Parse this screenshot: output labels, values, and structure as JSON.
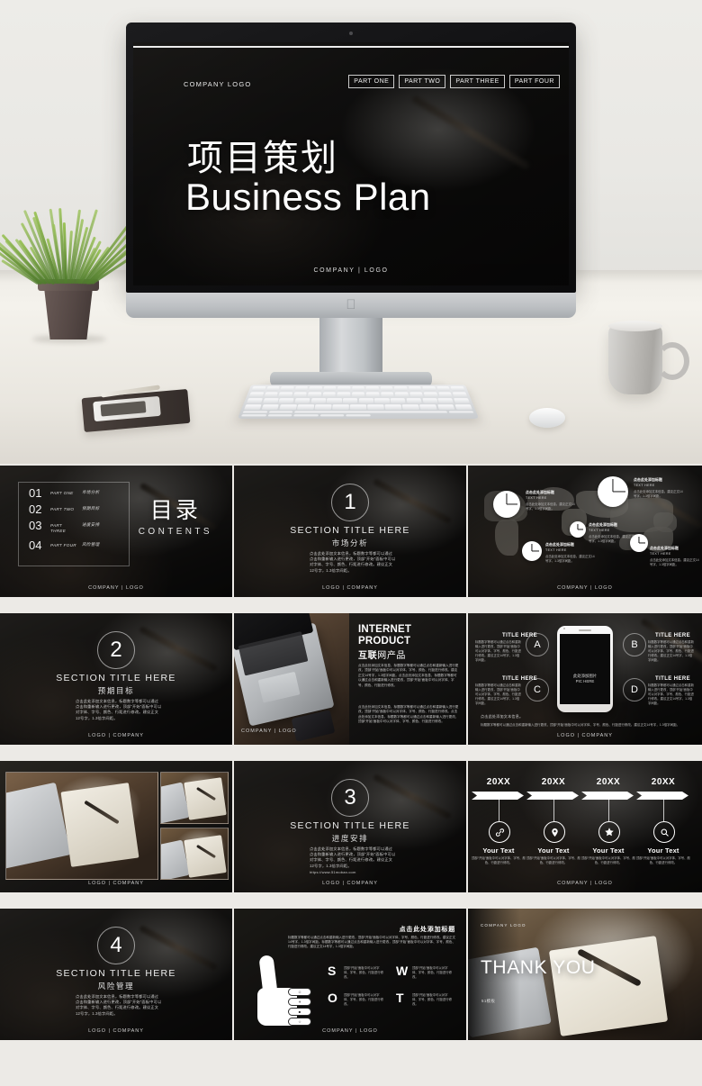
{
  "hero": {
    "nav": [
      "PART ONE",
      "PART TWO",
      "PART THREE",
      "PART FOUR"
    ],
    "logo": "COMPANY LOGO",
    "title_cn": "项目策划",
    "title_en": "Business Plan",
    "footer": "COMPANY | LOGO"
  },
  "toc": {
    "items": [
      {
        "num": "01",
        "part": "PART ONE",
        "label": "市场分析"
      },
      {
        "num": "02",
        "part": "PART TWO",
        "label": "预期目标"
      },
      {
        "num": "03",
        "part": "PART THREE",
        "label": "进度安排"
      },
      {
        "num": "04",
        "part": "PART FOUR",
        "label": "风险管理"
      }
    ],
    "title_cn": "目录",
    "title_en": "CONTENTS",
    "footer": "COMPANY | LOGO"
  },
  "sections": [
    {
      "num": "1",
      "en": "SECTION TITLE HERE",
      "cn": "市场分析",
      "body": "点击此处添加文本信息，标题数字等都可以通过点击和重新输入进行更改，顶部“开始”面板中可以对字体、字号、颜色、行距进行修改。建议正文12号字，1.3倍字间距。",
      "url": "",
      "footer": "LOGO | COMPANY"
    },
    {
      "num": "2",
      "en": "SECTION TITLE HERE",
      "cn": "预期目标",
      "body": "点击此处添加文本信息，标题数字等都可以通过点击和重新输入进行更改，顶部“开始”面板中可以对字体、字号、颜色、行距进行修改。建议正文12号字，1.3倍字间距。",
      "url": "",
      "footer": "LOGO | COMPANY"
    },
    {
      "num": "3",
      "en": "SECTION TITLE HERE",
      "cn": "进度安排",
      "body": "点击此处添加文本信息，标题数字等都可以通过点击和重新输入进行更改，顶部“开始”面板中可以对字体、字号、颜色、行距进行修改。建议正文12号字，1.3倍字间距。",
      "url": "https://www.51moban.com",
      "footer": "LOGO | COMPANY"
    },
    {
      "num": "4",
      "en": "SECTION TITLE HERE",
      "cn": "风险管理",
      "body": "点击此处添加文本信息，标题数字等都可以通过点击和重新输入进行更改，顶部“开始”面板中可以对字体、字号、颜色、行距进行修改。建议正文12号字，1.3倍字间距。",
      "url": "",
      "footer": "LOGO | COMPANY"
    }
  ],
  "map_slide": {
    "footer": "COMPANY | LOGO",
    "callouts": [
      {
        "h": "点击此处添加标题",
        "s": "TEXT HERE",
        "b": "点击此处添加文本信息。建议正文14号字，1.3倍字间距。"
      },
      {
        "h": "点击此处添加标题",
        "s": "TEXT HERE",
        "b": "点击此处添加文本信息。建议正文14号字，1.3倍字间距。"
      },
      {
        "h": "点击此处添加标题",
        "s": "TEXT HERE",
        "b": "点击此处添加文本信息。建议正文14号字，1.3倍字间距。"
      },
      {
        "h": "点击此处添加标题",
        "s": "TEXT HERE",
        "b": "点击此处添加文本信息。建议正文14号字，1.3倍字间距。"
      },
      {
        "h": "点击此处添加标题",
        "s": "TEXT HERE",
        "b": "点击此处添加文本信息。建议正文14号字，1.3倍字间距。"
      }
    ]
  },
  "internet": {
    "h1": "INTERNET PRODUCT",
    "h2_pre": "互",
    "h2_mid": "联",
    "h2_post": "网产品",
    "p1": "点击此处添加文本信息，标题数字等都可以通过点击和重新输入进行更改，顶部“开始”面板中可以对字体、字号、颜色、行距进行修改。建议正文14号字，1.3倍字间距。点击此处添加文本信息，标题数字等都可以通过点击和重新输入进行更改，顶部“开始”面板中可以对字体、字号、颜色、行距进行修改。",
    "p2": "点击此处添加文本信息，标题数字等都可以通过点击和重新输入进行更改，顶部“开始”面板中可以对字体、字号、颜色、行距进行修改。点击此处添加文本信息，标题数字等都可以通过点击和重新输入进行更改，顶部“开始”面板中可以对字体、字号、颜色、行距进行修改。",
    "footer": "COMPANY | LOGO"
  },
  "phone_slide": {
    "pic_cn": "此处添加图片",
    "pic_en": "PIC HERE",
    "items": [
      {
        "letter": "A",
        "title": "TITLE HERE",
        "body": "标题数字等都可以通过点击和重新输入进行更改，顶部“开始”面板中可以对字体、字号、颜色、行距进行修改。建议正文14号字，1.3倍字间距。"
      },
      {
        "letter": "B",
        "title": "TITLE HERE",
        "body": "标题数字等都可以通过点击和重新输入进行更改，顶部“开始”面板中可以对字体、字号、颜色、行距进行修改。建议正文14号字，1.3倍字间距。"
      },
      {
        "letter": "C",
        "title": "TITLE HERE",
        "body": "标题数字等都可以通过点击和重新输入进行更改，顶部“开始”面板中可以对字体、字号、颜色、行距进行修改。建议正文14号字，1.3倍字间距。"
      },
      {
        "letter": "D",
        "title": "TITLE HERE",
        "body": "标题数字等都可以通过点击和重新输入进行更改，顶部“开始”面板中可以对字体、字号、颜色、行距进行修改。建议正文14号字，1.3倍字间距。"
      }
    ],
    "note1": "点击此处添加文本信息。",
    "note2": "标题数字等都可以通过点击和重新输入进行更改，顶部“开始”面板中可以对字体、字号、颜色、行距进行修改。建议正文14号字，1.3倍字间距。",
    "footer": "LOGO | COMPANY"
  },
  "collage": {
    "footer": "LOGO | COMPANY"
  },
  "timeline": {
    "items": [
      {
        "year": "20XX",
        "icon": "link-icon",
        "title": "Your Text",
        "body": "顶部“开始”面板中可以对字体、字号、颜色、行距进行修改。"
      },
      {
        "year": "20XX",
        "icon": "location-icon",
        "title": "Your Text",
        "body": "顶部“开始”面板中可以对字体、字号、颜色、行距进行修改。"
      },
      {
        "year": "20XX",
        "icon": "star-icon",
        "title": "Your Text",
        "body": "顶部“开始”面板中可以对字体、字号、颜色、行距进行修改。"
      },
      {
        "year": "20XX",
        "icon": "search-icon",
        "title": "Your Text",
        "body": "顶部“开始”面板中可以对字体、字号、颜色、行距进行修改。"
      }
    ],
    "footer": "COMPANY | LOGO"
  },
  "swot": {
    "title": "点击此处添加标题",
    "intro": "标题数字等都可以通过点击和重新输入进行更改，顶部“开始”面板中可以对字体、字号、颜色、行距进行修改。建议正文14号字，1.3倍字间距。标题数字等都可以通过点击和重新输入进行更改，顶部“开始”面板中可以对字体、字号、颜色、行距进行修改。建议正文14号字，1.3倍字间距。",
    "cells": [
      {
        "letter": "S",
        "body": "顶部“开始”面板中可以对字体、字号、颜色、行距进行修改。"
      },
      {
        "letter": "W",
        "body": "顶部“开始”面板中可以对字体、字号、颜色、行距进行修改。"
      },
      {
        "letter": "O",
        "body": "顶部“开始”面板中可以对字体、字号、颜色、行距进行修改。"
      },
      {
        "letter": "T",
        "body": "顶部“开始”面板中可以对字体、字号、颜色、行距进行修改。"
      }
    ],
    "footer": "COMPANY | LOGO"
  },
  "thankyou": {
    "logo": "COMPANY LOGO",
    "title": "THANK YOU",
    "sub": "51模板"
  }
}
